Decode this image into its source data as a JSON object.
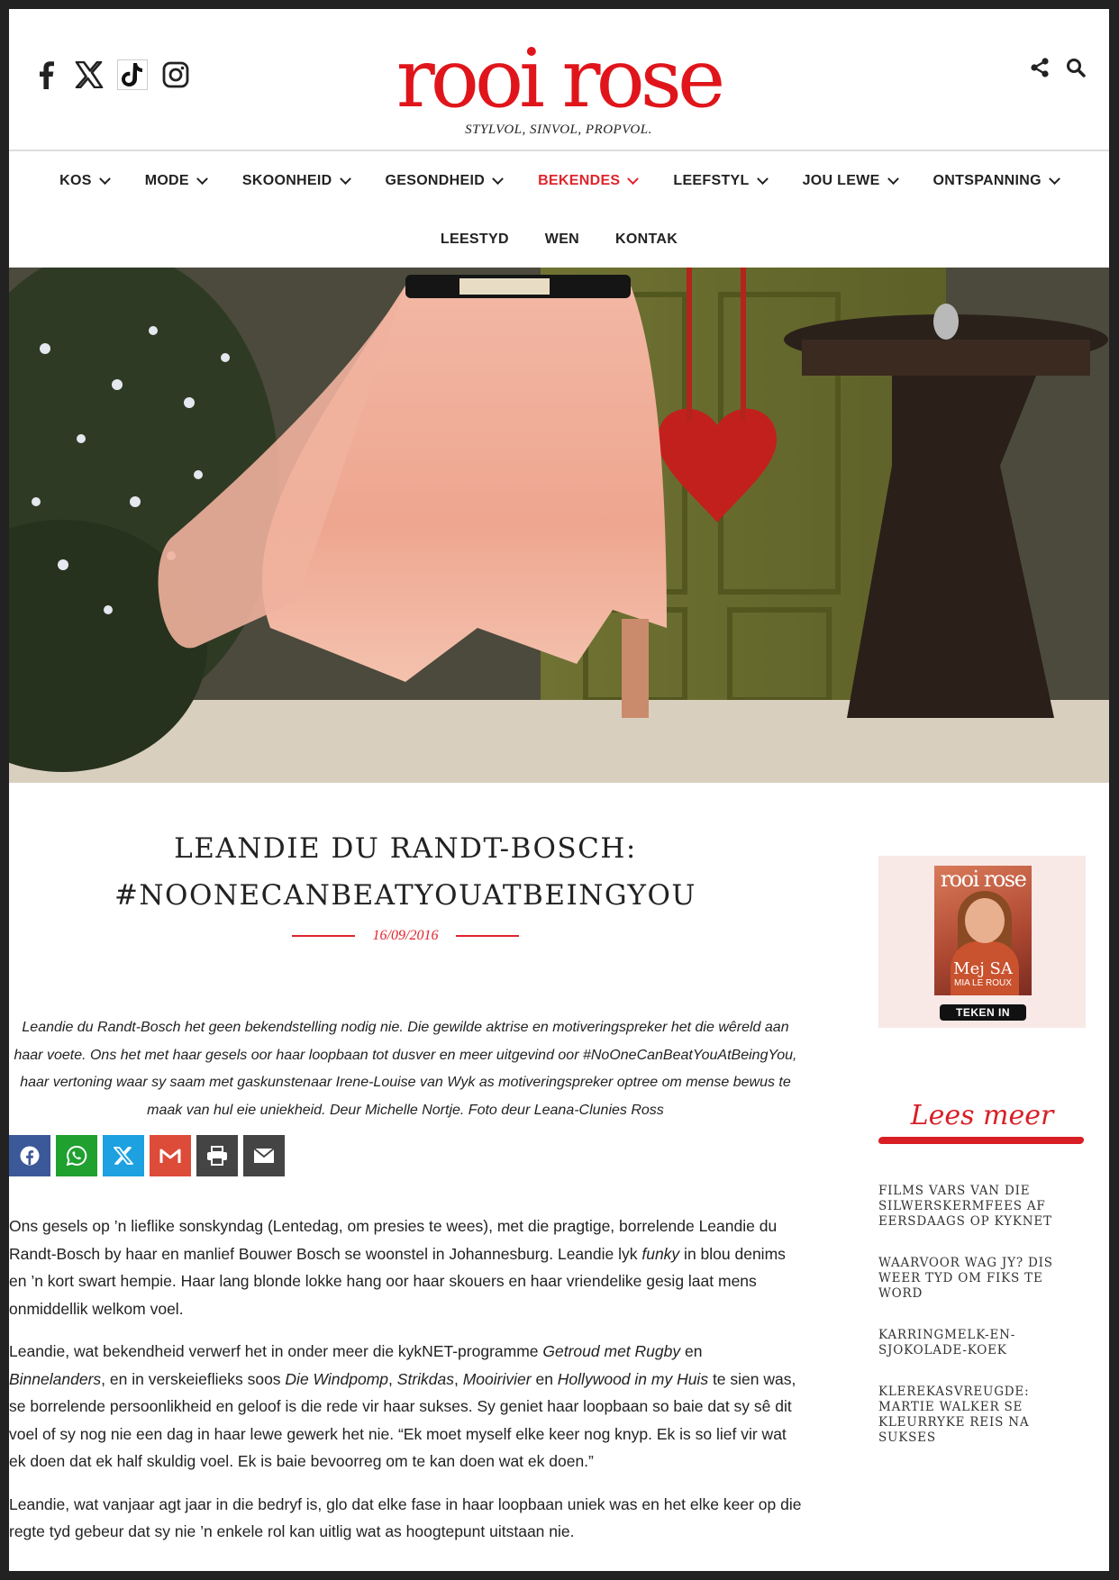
{
  "header": {
    "logo": "rooi rose",
    "tagline": "STYLVOL, SINVOL, PROPVOL.",
    "social_icons": [
      "facebook-icon",
      "x-icon",
      "tiktok-icon",
      "instagram-icon"
    ],
    "tool_icons": [
      "share-icon",
      "search-icon"
    ]
  },
  "nav": {
    "row1": [
      {
        "label": "KOS",
        "has_menu": true
      },
      {
        "label": "MODE",
        "has_menu": true
      },
      {
        "label": "SKOONHEID",
        "has_menu": true
      },
      {
        "label": "GESONDHEID",
        "has_menu": true
      },
      {
        "label": "BEKENDES",
        "has_menu": true,
        "active": true
      },
      {
        "label": "LEEFSTYL",
        "has_menu": true
      },
      {
        "label": "JOU LEWE",
        "has_menu": true
      },
      {
        "label": "ONTSPANNING",
        "has_menu": true
      }
    ],
    "row2": [
      {
        "label": "LEESTYD"
      },
      {
        "label": "WEN"
      },
      {
        "label": "KONTAK"
      }
    ]
  },
  "article": {
    "title_line1": "LEANDIE DU RANDT-BOSCH:",
    "title_line2": "#NOONECANBEATYOUATBEINGYOU",
    "date": "16/09/2016",
    "intro": "Leandie du Randt-Bosch het geen bekendstelling nodig nie. Die gewilde aktrise en motiveringspreker het die wêreld aan haar voete. Ons het met haar gesels oor haar loopbaan tot dusver en meer uitgevind oor #NoOneCanBeatYouAtBeingYou, haar vertoning waar sy saam met gaskunstenaar Irene-Louise van Wyk as motiveringspreker optree om mense bewus te maak van hul eie uniekheid. Deur Michelle Nortje. Foto deur Leana-Clunies Ross",
    "share_buttons": [
      {
        "name": "facebook",
        "color": "#3b5998"
      },
      {
        "name": "whatsapp",
        "color": "#1fa02f"
      },
      {
        "name": "x",
        "color": "#1da1e0"
      },
      {
        "name": "gmail",
        "color": "#dd4b39"
      },
      {
        "name": "print",
        "color": "#444444"
      },
      {
        "name": "email",
        "color": "#444444"
      }
    ],
    "p1_a": "Ons gesels op ’n lieflike sonskyndag (Lentedag, om presies te wees), met die pragtige, borrelende Leandie du Randt-Bosch by haar en manlief Bouwer Bosch se woonstel in Johannesburg. Leandie lyk ",
    "p1_em": "funky",
    "p1_b": " in blou denims en ’n kort swart hempie. Haar lang blonde lokke hang oor haar skouers en haar vriendelike gesig laat mens onmiddellik welkom voel.",
    "p2_a": "Leandie, wat bekendheid verwerf het in onder meer die kykNET-programme ",
    "p2_em1": "Getroud met Rugby",
    "p2_b": " en ",
    "p2_em2": "Binnelanders",
    "p2_c": ", en in verskeieflieks soos ",
    "p2_em3": "Die Windpomp",
    "p2_d": ", ",
    "p2_em4": "Strikdas",
    "p2_e": ", ",
    "p2_em5": "Mooirivier",
    "p2_f": " en ",
    "p2_em6": "Hollywood in my Huis",
    "p2_g": " te sien was, se borrelende persoonlikheid en geloof is die rede vir haar sukses. Sy geniet haar loopbaan so baie dat sy sê dit voel of sy nog nie een dag in haar lewe gewerk het nie. “Ek moet myself elke keer nog knyp. Ek is so lief vir wat ek doen dat ek half skuldig voel. Ek is baie bevoorreg om te kan doen wat ek doen.”",
    "p3": "Leandie, wat vanjaar agt jaar in die bedryf is, glo dat elke fase in haar loopbaan uniek was en het elke keer op die regte tyd gebeur dat sy nie ’n enkele rol kan uitlig wat as hoogtepunt uitstaan nie."
  },
  "sidebar": {
    "magazine": {
      "name": "rooi rose",
      "cover_line": "Mej SA",
      "cover_sub": "MIA LE ROUX",
      "subscribe_label": "TEKEN IN"
    },
    "lees_meer": "Lees meer",
    "links": [
      "FILMS VARS VAN DIE SILWERSKERMFEES AF EERSDAAGS OP KYKNET",
      "WAARVOOR WAG JY? DIS WEER TYD OM FIKS TE WORD",
      "KARRINGMELK-EN-SJOKOLADE-KOEK",
      "KLEREKASVREUGDE: MARTIE WALKER SE KLEURRYKE REIS NA SUKSES"
    ]
  },
  "colors": {
    "brand_red": "#e0151b",
    "active_nav": "#e0242c",
    "sidebar_bg": "#f8e8e6"
  }
}
